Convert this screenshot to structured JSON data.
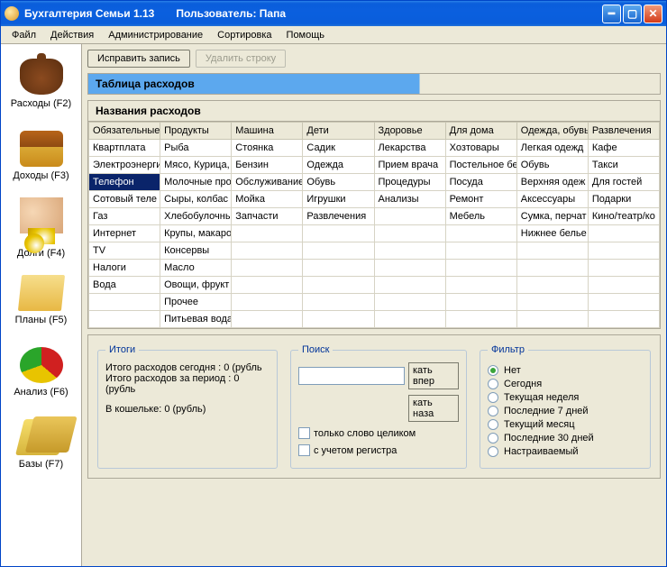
{
  "title": "Бухгалтерия Семьи 1.13",
  "user_label": "Пользователь: Папа",
  "menu": [
    "Файл",
    "Действия",
    "Администрирование",
    "Сортировка",
    "Помощь"
  ],
  "nav": [
    {
      "label": "Расходы (F2)"
    },
    {
      "label": "Доходы (F3)"
    },
    {
      "label": "Долги (F4)"
    },
    {
      "label": "Планы (F5)"
    },
    {
      "label": "Анализ (F6)"
    },
    {
      "label": "Базы (F7)"
    }
  ],
  "toolbar": {
    "edit": "Исправить запись",
    "delete": "Удалить строку"
  },
  "section_title": "Таблица расходов",
  "subsection_title": "Названия расходов",
  "columns": [
    "Обязательные",
    "Продукты",
    "Машина",
    "Дети",
    "Здоровье",
    "Для дома",
    "Одежда, обувь",
    "Развлечения"
  ],
  "rows": [
    [
      "Квартплата",
      "Рыба",
      "Стоянка",
      "Садик",
      "Лекарства",
      "Хозтовары",
      "Легкая одежд",
      "Кафе"
    ],
    [
      "Электроэнерги",
      "Мясо, Курица,",
      "Бензин",
      "Одежда",
      "Прием врача",
      "Постельное бе",
      "Обувь",
      "Такси"
    ],
    [
      "Телефон",
      "Молочные про",
      "Обслуживание",
      "Обувь",
      "Процедуры",
      "Посуда",
      "Верхняя одеж",
      "Для гостей"
    ],
    [
      "Сотовый теле",
      "Сыры, колбас",
      "Мойка",
      "Игрушки",
      "Анализы",
      "Ремонт",
      "Аксессуары",
      "Подарки"
    ],
    [
      "Газ",
      "Хлебобулочны",
      "Запчасти",
      "Развлечения",
      "",
      "Мебель",
      "Сумка, перчат",
      "Кино/театр/ко"
    ],
    [
      "Интернет",
      "Крупы, макаро",
      "",
      "",
      "",
      "",
      "Нижнее белье",
      ""
    ],
    [
      "TV",
      "Консервы",
      "",
      "",
      "",
      "",
      "",
      ""
    ],
    [
      "Налоги",
      "Масло",
      "",
      "",
      "",
      "",
      "",
      ""
    ],
    [
      "Вода",
      "Овощи, фрукт",
      "",
      "",
      "",
      "",
      "",
      ""
    ],
    [
      "",
      "Прочее",
      "",
      "",
      "",
      "",
      "",
      ""
    ],
    [
      "",
      "Питьевая вода",
      "",
      "",
      "",
      "",
      "",
      ""
    ]
  ],
  "selected": {
    "row": 2,
    "col": 0
  },
  "totals": {
    "legend": "Итоги",
    "today": "Итого расходов сегодня : 0 (рубль",
    "period": "Итого расходов за период : 0 (рубль",
    "wallet": "В кошельке: 0 (рубль)"
  },
  "search": {
    "legend": "Поиск",
    "btn_fwd": "кать впер",
    "btn_back": "кать наза",
    "whole_word": "только слово целиком",
    "case": "с учетом регистра"
  },
  "filter": {
    "legend": "Фильтр",
    "options": [
      "Нет",
      "Сегодня",
      "Текущая неделя",
      "Последние 7 дней",
      "Текущий месяц",
      "Последние 30 дней",
      "Настраиваемый"
    ],
    "selected": 0
  }
}
